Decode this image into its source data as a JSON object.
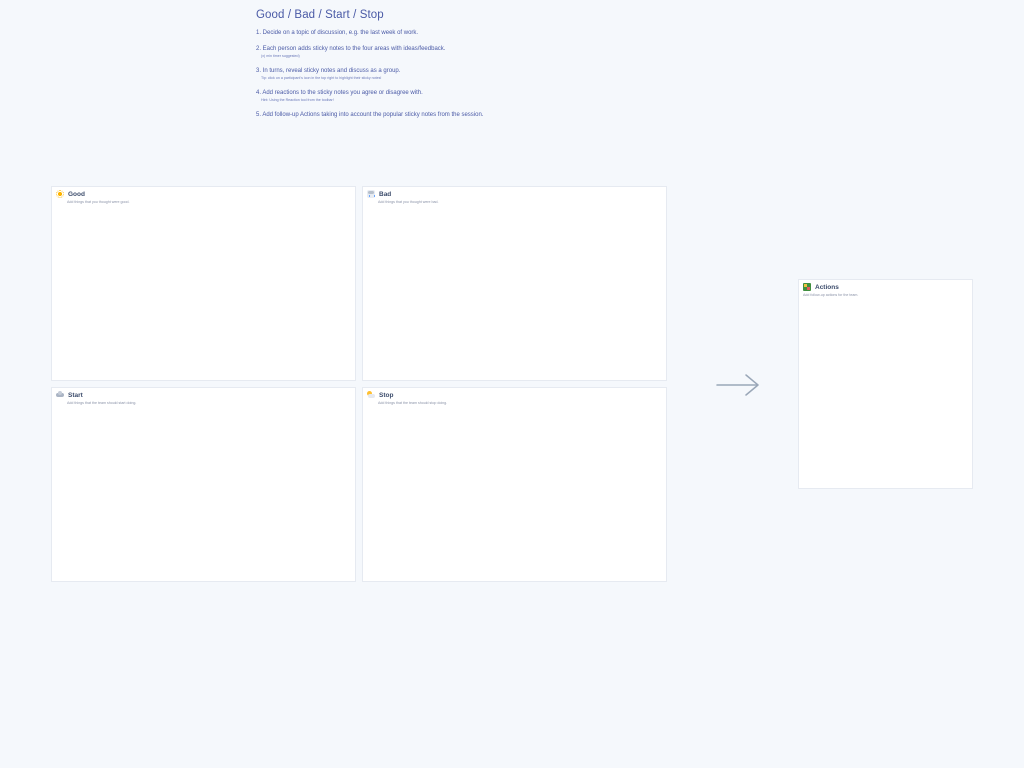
{
  "instructions": {
    "title": "Good / Bad / Start / Stop",
    "steps": [
      {
        "main": "1. Decide on a topic of discussion, e.g. the last week of work.",
        "sub": ""
      },
      {
        "main": "2. Each person adds sticky notes to the four areas with ideas/feedback.",
        "sub": "(x) min timer suggested)"
      },
      {
        "main": "3. In turns, reveal sticky notes and discuss as a group.",
        "sub": "Tip: click on a participant's icon in the top right to highlight their sticky notes!"
      },
      {
        "main": "4. Add reactions to the sticky notes you agree or disagree with.",
        "sub": "Hint: Using the Reaction tool from the toolbar!"
      },
      {
        "main": "5. Add follow-up Actions taking into account the popular sticky notes from the session.",
        "sub": ""
      }
    ]
  },
  "panels": {
    "good": {
      "name": "Good",
      "desc": "Add things that you thought were good.",
      "icon": "sun-icon"
    },
    "bad": {
      "name": "Bad",
      "desc": "Add things that you thought were bad.",
      "icon": "rain-icon"
    },
    "start": {
      "name": "Start",
      "desc": "Add things that the team should start doing.",
      "icon": "cloud-icon"
    },
    "stop": {
      "name": "Stop",
      "desc": "Add things that the team should stop doing.",
      "icon": "partly-sunny-icon"
    },
    "actions": {
      "name": "Actions",
      "desc": "Add follow-up actions for the team.",
      "icon": "actions-icon"
    }
  },
  "colors": {
    "background": "#f5f8fc",
    "accent": "#4a5aa6",
    "arrow": "#9aa7b8"
  }
}
